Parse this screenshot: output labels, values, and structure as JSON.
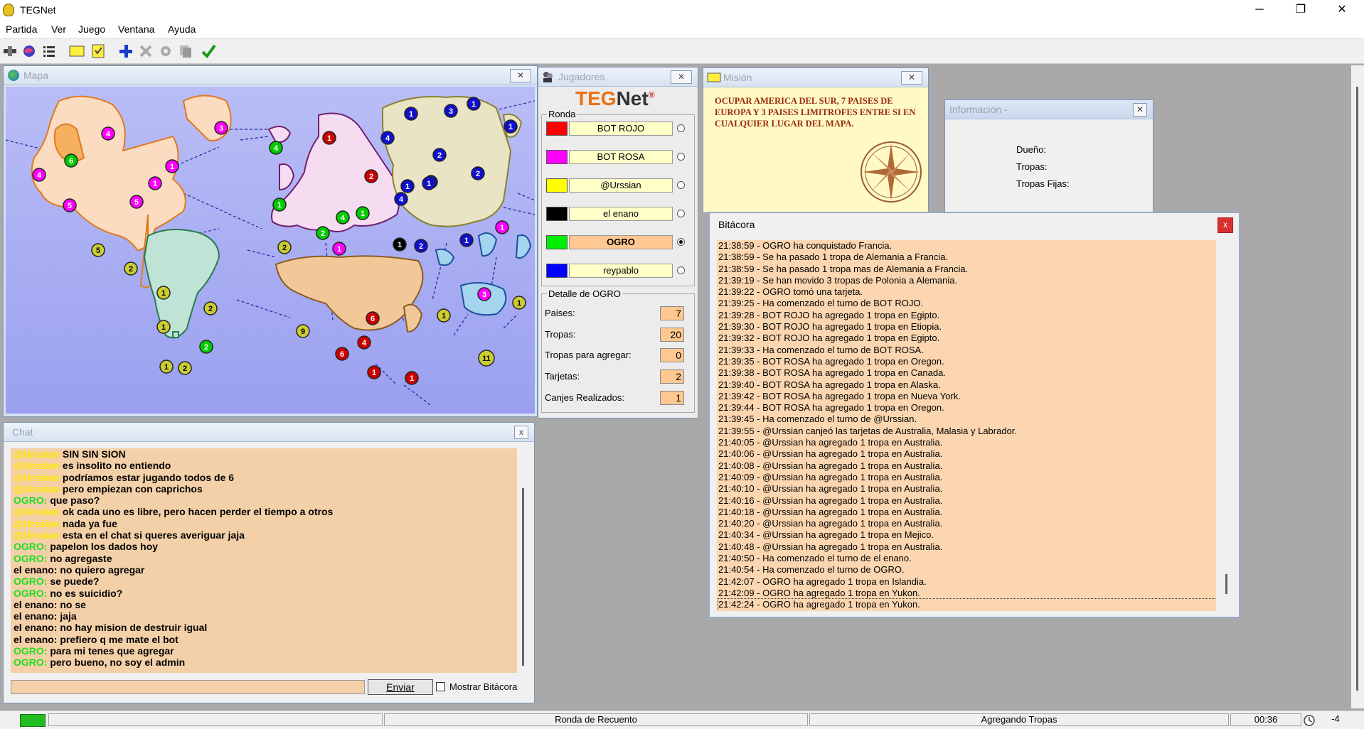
{
  "window": {
    "title": "TEGNet",
    "minimize": "─",
    "maximize": "❐",
    "close": "✕"
  },
  "menu": [
    "Partida",
    "Ver",
    "Juego",
    "Ventana",
    "Ayuda"
  ],
  "colors": {
    "accent": "#ffc890",
    "chat_bg": "#f4d0a8",
    "log_bg": "#fcd6b0",
    "mission_bg": "#fff9c4",
    "ogro_green": "#22dd22",
    "ursian_yellow": "#ffe800"
  },
  "toolbar_icons": [
    "connect-icon",
    "globe-icon",
    "list-icon",
    "card-icon",
    "mission-icon",
    "add-icon",
    "cancel-icon",
    "gear-icon",
    "copy-icon",
    "check-icon"
  ],
  "mapa": {
    "title": "Mapa",
    "close": "✕"
  },
  "jugadores": {
    "title": "Jugadores",
    "close": "✕",
    "logo_teg": "TEG",
    "logo_net": "Net",
    "logo_mark": "®",
    "ronda_label": "Ronda",
    "players": [
      {
        "name": "BOT ROJO",
        "color": "#ff0000"
      },
      {
        "name": "BOT ROSA",
        "color": "#ff00ff"
      },
      {
        "name": "@Urssian",
        "color": "#ffff00"
      },
      {
        "name": "el enano",
        "color": "#000000"
      },
      {
        "name": "OGRO",
        "color": "#00ee00"
      },
      {
        "name": "reypablo",
        "color": "#0000ff"
      }
    ],
    "detalle_label": "Detalle de OGRO",
    "stats": [
      {
        "label": "Paises:",
        "value": "7"
      },
      {
        "label": "Tropas:",
        "value": "20"
      },
      {
        "label": "Tropas para agregar:",
        "value": "0"
      },
      {
        "label": "Tarjetas:",
        "value": "2"
      },
      {
        "label": "Canjes Realizados:",
        "value": "1"
      }
    ]
  },
  "mision": {
    "title": "Misión",
    "close": "✕",
    "text": "OCUPAR AMERICA DEL SUR, 7 PAISES DE EUROPA Y 3 PAISES LIMITROFES ENTRE SI EN CUALQUIER LUGAR DEL MAPA."
  },
  "informacion": {
    "title": "Información -",
    "close": "✕",
    "dueno": "Dueño:",
    "tropas": "Tropas:",
    "tropas_fijas": "Tropas Fijas:"
  },
  "bitacora": {
    "title": "Bitácora",
    "close": "x",
    "lines": [
      "21:38:59 - OGRO ha conquistado Francia.",
      "21:38:59 - Se ha pasado 1 tropa de Alemania a Francia.",
      "21:38:59 - Se ha pasado 1 tropa mas de Alemania a Francia.",
      "21:39:19 - Se han movido 3 tropas de Polonia a Alemania.",
      "21:39:22 - OGRO tomó una tarjeta.",
      "21:39:25 - Ha comenzado el turno de BOT ROJO.",
      "21:39:28 - BOT ROJO ha agregado 1 tropa en Egipto.",
      "21:39:30 - BOT ROJO ha agregado 1 tropa en Etiopia.",
      "21:39:32 - BOT ROJO ha agregado 1 tropa en Egipto.",
      "21:39:33 - Ha comenzado el turno de BOT ROSA.",
      "21:39:35 - BOT ROSA ha agregado 1 tropa en Oregon.",
      "21:39:38 - BOT ROSA ha agregado 1 tropa en Canada.",
      "21:39:40 - BOT ROSA ha agregado 1 tropa en Alaska.",
      "21:39:42 - BOT ROSA ha agregado 1 tropa en Nueva York.",
      "21:39:44 - BOT ROSA ha agregado 1 tropa en Oregon.",
      "21:39:45 - Ha comenzado el turno de @Urssian.",
      "21:39:55 - @Urssian canjeó las tarjetas de Australia, Malasia y Labrador.",
      "21:40:05 - @Urssian ha agregado 1 tropa en Australia.",
      "21:40:06 - @Urssian ha agregado 1 tropa en Australia.",
      "21:40:08 - @Urssian ha agregado 1 tropa en Australia.",
      "21:40:09 - @Urssian ha agregado 1 tropa en Australia.",
      "21:40:10 - @Urssian ha agregado 1 tropa en Australia.",
      "21:40:16 - @Urssian ha agregado 1 tropa en Australia.",
      "21:40:18 - @Urssian ha agregado 1 tropa en Australia.",
      "21:40:20 - @Urssian ha agregado 1 tropa en Australia.",
      "21:40:34 - @Urssian ha agregado 1 tropa en Mejico.",
      "21:40:48 - @Urssian ha agregado 1 tropa en Australia.",
      "21:40:50 - Ha comenzado el turno de el enano.",
      "21:40:54 - Ha comenzado el turno de OGRO.",
      "21:42:07 - OGRO ha agregado 1 tropa en Islandia.",
      "21:42:09 - OGRO ha agregado 1 tropa en Yukon.",
      "21:42:24 - OGRO ha agregado 1 tropa en Yukon."
    ]
  },
  "chat": {
    "title": "Chat",
    "close": "x",
    "messages": [
      {
        "who": "@Urssian",
        "text": "SIN SIN SION",
        "color": "#ffe800"
      },
      {
        "who": "@Urssian",
        "text": "es insolito no entiendo",
        "color": "#ffe800"
      },
      {
        "who": "@Urssian",
        "text": "podríamos estar jugando todos de 6",
        "color": "#ffe800"
      },
      {
        "who": "@Urssian",
        "text": "pero empiezan con caprichos",
        "color": "#ffe800"
      },
      {
        "who": "OGRO:",
        "text": "que paso?",
        "color": "#22dd22"
      },
      {
        "who": "@Urssian",
        "text": "ok cada uno es libre, pero hacen perder el tiempo a otros",
        "color": "#ffe800"
      },
      {
        "who": "@Urssian",
        "text": "nada ya fue",
        "color": "#ffe800"
      },
      {
        "who": "@Urssian",
        "text": "esta en el chat si queres averiguar jaja",
        "color": "#ffe800"
      },
      {
        "who": "OGRO:",
        "text": "papelon los dados hoy",
        "color": "#22dd22"
      },
      {
        "who": "OGRO:",
        "text": "no agregaste",
        "color": "#22dd22"
      },
      {
        "who": "el enano:",
        "text": "no quiero agregar",
        "color": "#000000"
      },
      {
        "who": "OGRO:",
        "text": "se puede?",
        "color": "#22dd22"
      },
      {
        "who": "OGRO:",
        "text": "no es suicidio?",
        "color": "#22dd22"
      },
      {
        "who": "el enano:",
        "text": "no se",
        "color": "#000000"
      },
      {
        "who": "el enano:",
        "text": "jaja",
        "color": "#000000"
      },
      {
        "who": "el enano:",
        "text": "no hay mision de destruir igual",
        "color": "#000000"
      },
      {
        "who": "el enano:",
        "text": "prefiero q me mate el bot",
        "color": "#000000"
      },
      {
        "who": "OGRO:",
        "text": "para mi tenes que agregar",
        "color": "#22dd22"
      },
      {
        "who": "OGRO:",
        "text": "pero bueno, no soy el admin",
        "color": "#22dd22"
      }
    ],
    "input_value": "",
    "send_button": "Enviar",
    "checkbox_label": "Mostrar Bitácora"
  },
  "territories": [
    {
      "id": "t1",
      "owner": "#ff00ff",
      "troops": "4",
      "fill": "#fbdcc0"
    },
    {
      "id": "t2",
      "owner": "#00cc00",
      "troops": "6",
      "fill": "#f5b060"
    },
    {
      "id": "t3",
      "owner": "#ff00ff",
      "troops": "4",
      "fill": "#fbdcc0"
    },
    {
      "id": "t4",
      "owner": "#ff00ff",
      "troops": "1",
      "fill": "#fbdcc0"
    },
    {
      "id": "t5",
      "owner": "#ff00ff",
      "troops": "1",
      "fill": "#fbdcc0"
    },
    {
      "id": "t6",
      "owner": "#ff00ff",
      "troops": "5",
      "fill": "#fbdcc0"
    },
    {
      "id": "t7",
      "owner": "#ff00ff",
      "troops": "5",
      "fill": "#fbdcc0"
    },
    {
      "id": "t8",
      "owner": "#ff00ff",
      "troops": "3",
      "fill": "#fbdcc0"
    },
    {
      "id": "t9",
      "owner": "#cccc33",
      "troops": "5",
      "fill": "#fbdcc0"
    },
    {
      "id": "t10",
      "owner": "#cccc33",
      "troops": "2",
      "fill": "#fbdcc0"
    },
    {
      "id": "t11",
      "owner": "#cccc33",
      "troops": "1",
      "fill": "#bfe3d4"
    },
    {
      "id": "t12",
      "owner": "#cccc33",
      "troops": "2",
      "fill": "#bfe3d4"
    },
    {
      "id": "t13",
      "owner": "#cccc33",
      "troops": "1",
      "fill": "#bfe3d4"
    },
    {
      "id": "t14",
      "owner": "#00cc00",
      "troops": "2",
      "fill": "#bfe3d4"
    },
    {
      "id": "t15",
      "owner": "#cccc33",
      "troops": "1",
      "fill": "#bfe3d4"
    },
    {
      "id": "t16",
      "owner": "#cccc33",
      "troops": "2",
      "fill": "#bfe3d4"
    },
    {
      "id": "t17",
      "owner": "#00cc00",
      "troops": "4",
      "fill": "#f6dcf0"
    },
    {
      "id": "t18",
      "owner": "#00cc00",
      "troops": "1",
      "fill": "#f6dcf0"
    },
    {
      "id": "t19",
      "owner": "#cc0000",
      "troops": "1",
      "fill": "#f6dcf0"
    },
    {
      "id": "t20",
      "owner": "#cc0000",
      "troops": "2",
      "fill": "#f6dcf0"
    },
    {
      "id": "t21",
      "owner": "#00cc00",
      "troops": "2",
      "fill": "#f6dcf0"
    },
    {
      "id": "t22",
      "owner": "#00cc00",
      "troops": "4",
      "fill": "#f6dcf0"
    },
    {
      "id": "t23",
      "owner": "#00cc00",
      "troops": "1",
      "fill": "#f6dcf0"
    },
    {
      "id": "t24",
      "owner": "#cccc33",
      "troops": "2",
      "fill": "#f6dcf0"
    },
    {
      "id": "t25",
      "owner": "#ff00ff",
      "troops": "1",
      "fill": "#f6dcf0"
    },
    {
      "id": "t26",
      "owner": "#000000",
      "troops": "1",
      "fill": "#e8e4c4"
    },
    {
      "id": "t27",
      "owner": "#1010cc",
      "troops": "2",
      "fill": "#e8e4c4"
    },
    {
      "id": "t28",
      "owner": "#1010cc",
      "troops": "4",
      "fill": "#e8e4c4"
    },
    {
      "id": "t29",
      "owner": "#1010cc",
      "troops": "1",
      "fill": "#e8e4c4"
    },
    {
      "id": "t30",
      "owner": "#1010cc",
      "troops": "1",
      "fill": "#e8e4c4"
    },
    {
      "id": "t31",
      "owner": "#1010cc",
      "troops": "4",
      "fill": "#e8e4c4"
    },
    {
      "id": "t32",
      "owner": "#1010cc",
      "troops": "1",
      "fill": "#e8e4c4"
    },
    {
      "id": "t33",
      "owner": "#1010cc",
      "troops": "3",
      "fill": "#e8e4c4"
    },
    {
      "id": "t34",
      "owner": "#1010cc",
      "troops": "1",
      "fill": "#e8e4c4"
    },
    {
      "id": "t35",
      "owner": "#1010cc",
      "troops": "1",
      "fill": "#e8e4c4"
    },
    {
      "id": "t36",
      "owner": "#1010cc",
      "troops": "2",
      "fill": "#e8e4c4"
    },
    {
      "id": "t37",
      "owner": "#1010cc",
      "troops": "2",
      "fill": "#e8e4c4"
    },
    {
      "id": "t38",
      "owner": "#1010cc",
      "troops": "1",
      "fill": "#e8e4c4"
    },
    {
      "id": "t39",
      "owner": "#1010cc",
      "troops": "1",
      "fill": "#e8e4c4"
    },
    {
      "id": "t40",
      "owner": "#ff00ff",
      "troops": "1",
      "fill": "#e8e4c4"
    },
    {
      "id": "t41",
      "owner": "#cccc33",
      "troops": "9",
      "fill": "#f2c898"
    },
    {
      "id": "t42",
      "owner": "#cc0000",
      "troops": "6",
      "fill": "#f2c898"
    },
    {
      "id": "t43",
      "owner": "#cc0000",
      "troops": "4",
      "fill": "#f2c898"
    },
    {
      "id": "t44",
      "owner": "#cc0000",
      "troops": "6",
      "fill": "#f2c898"
    },
    {
      "id": "t45",
      "owner": "#cc0000",
      "troops": "1",
      "fill": "#f2c898"
    },
    {
      "id": "t46",
      "owner": "#cc0000",
      "troops": "1",
      "fill": "#f2c898"
    },
    {
      "id": "t47",
      "owner": "#cccc33",
      "troops": "1",
      "fill": "#a4d4ee"
    },
    {
      "id": "t48",
      "owner": "#ff00ff",
      "troops": "3",
      "fill": "#a4d4ee"
    },
    {
      "id": "t49",
      "owner": "#cccc33",
      "troops": "1",
      "fill": "#a4d4ee"
    },
    {
      "id": "t50",
      "owner": "#cccc33",
      "troops": "11",
      "fill": "#a4d4ee"
    }
  ],
  "statusbar": {
    "ronda": "Ronda de Recuento",
    "estado": "Agregando Tropas",
    "tiempo": "00:36",
    "extra": "-4",
    "indicator_color": "#22bb22"
  }
}
